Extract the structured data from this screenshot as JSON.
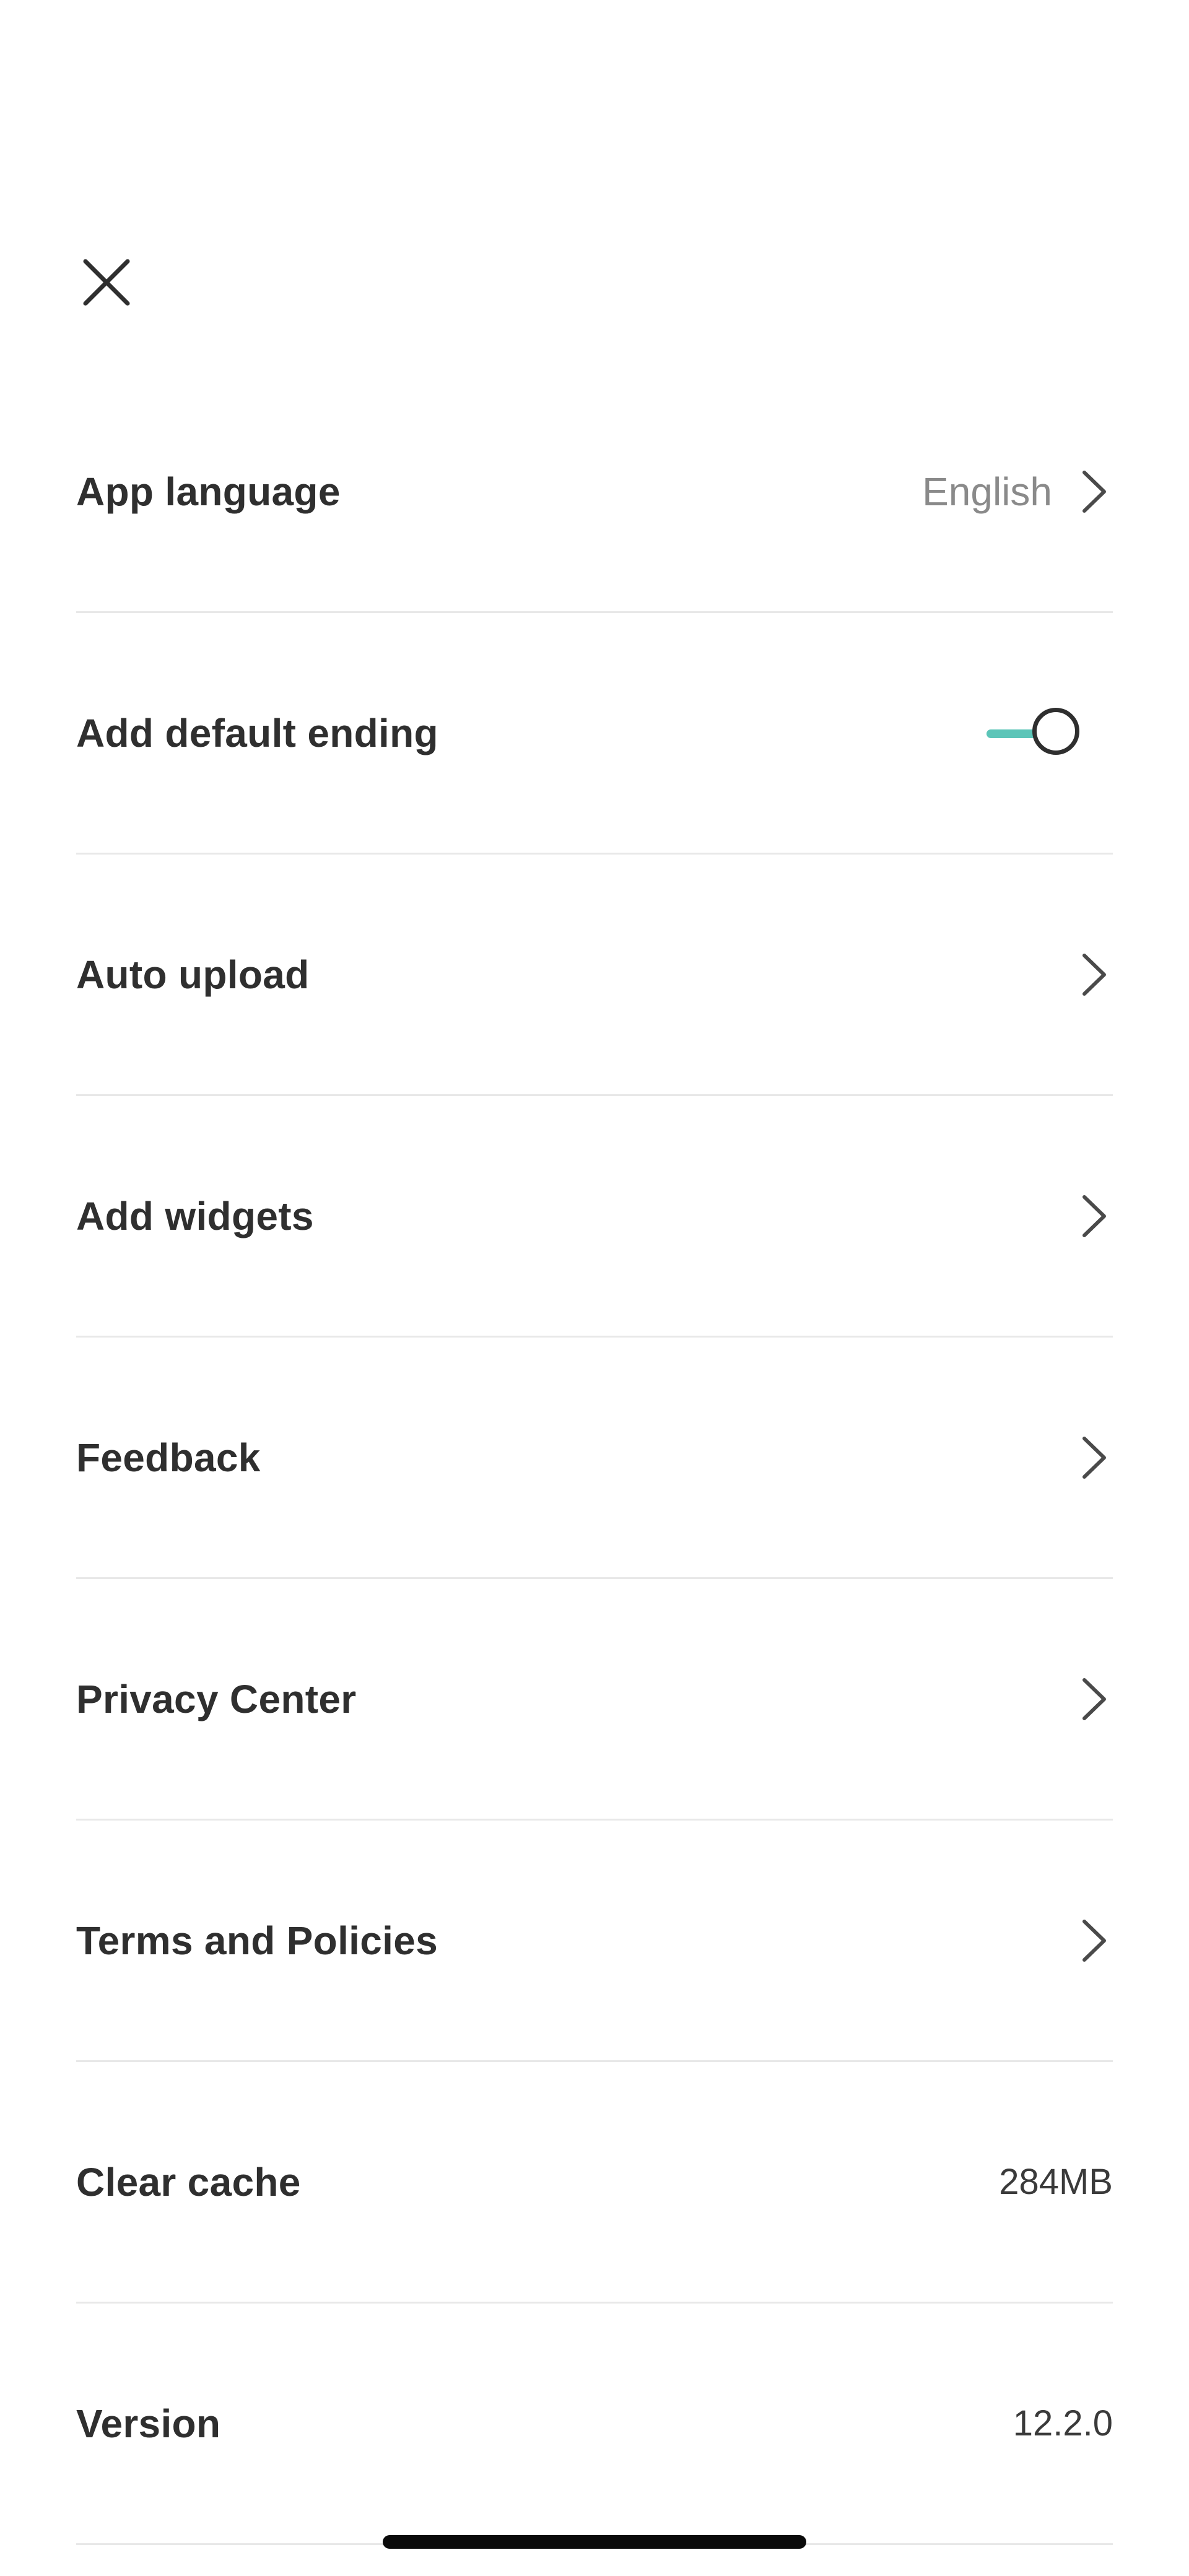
{
  "header": {
    "close_icon": "close-icon"
  },
  "colors": {
    "accent": "#5cc5b8",
    "text": "#2f2f2f",
    "muted": "#8a8a8a",
    "divider": "#e8e8e8"
  },
  "settings": {
    "app_language": {
      "label": "App language",
      "value": "English",
      "icon": "chevron-right-icon"
    },
    "default_ending": {
      "label": "Add default ending",
      "toggle_on": true
    },
    "auto_upload": {
      "label": "Auto upload",
      "icon": "chevron-right-icon"
    },
    "add_widgets": {
      "label": "Add widgets",
      "icon": "chevron-right-icon"
    },
    "feedback": {
      "label": "Feedback",
      "icon": "chevron-right-icon"
    },
    "privacy_center": {
      "label": "Privacy Center",
      "icon": "chevron-right-icon"
    },
    "terms": {
      "label": "Terms and Policies",
      "icon": "chevron-right-icon"
    },
    "clear_cache": {
      "label": "Clear cache",
      "value": "284MB"
    },
    "version": {
      "label": "Version",
      "value": "12.2.0"
    }
  }
}
